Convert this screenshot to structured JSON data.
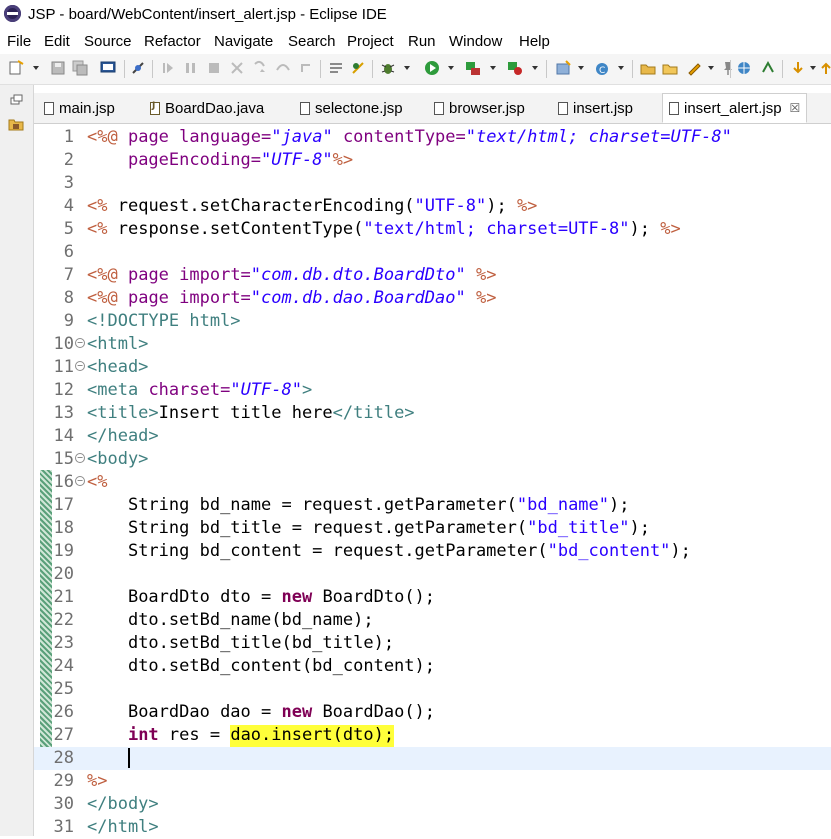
{
  "window": {
    "title": "JSP - board/WebContent/insert_alert.jsp - Eclipse IDE"
  },
  "menu": [
    "File",
    "Edit",
    "Source",
    "Refactor",
    "Navigate",
    "Search",
    "Project",
    "Run",
    "Window",
    "Help"
  ],
  "tabs": [
    {
      "label": "main.jsp",
      "icon": "jsp-file-icon"
    },
    {
      "label": "BoardDao.java",
      "icon": "java-file-icon"
    },
    {
      "label": "selectone.jsp",
      "icon": "jsp-file-icon"
    },
    {
      "label": "browser.jsp",
      "icon": "jsp-file-icon"
    },
    {
      "label": "insert.jsp",
      "icon": "jsp-file-icon"
    },
    {
      "label": "insert_alert.jsp",
      "icon": "jsp-file-icon",
      "active": true,
      "close": "☒"
    }
  ],
  "editor": {
    "line_numbers": [
      "1",
      "2",
      "3",
      "4",
      "5",
      "6",
      "7",
      "8",
      "9",
      "10",
      "11",
      "12",
      "13",
      "14",
      "15",
      "16",
      "17",
      "18",
      "19",
      "20",
      "21",
      "22",
      "23",
      "24",
      "25",
      "26",
      "27",
      "28",
      "29",
      "30",
      "31"
    ],
    "code": {
      "l1_attr1": "page language=",
      "l1_val1": "\"java\"",
      "l1_attr2": "contentType=",
      "l1_val2": "\"text/html; charset=UTF-8\"",
      "l2_attr": "pageEncoding=",
      "l2_val": "\"UTF-8\"",
      "l4_text": "request.setCharacterEncoding(",
      "l4_str": "\"UTF-8\"",
      "l4_end": ");",
      "l5_text": "response.setContentType(",
      "l5_str": "\"text/html; charset=UTF-8\"",
      "l5_end": ");",
      "l7_attr": "page import=",
      "l7_val": "\"com.db.dto.BoardDto\"",
      "l8_attr": "page import=",
      "l8_val": "\"com.db.dao.BoardDao\"",
      "l9_tag": "<!DOCTYPE html>",
      "l10_tag": "<html>",
      "l11_tag": "<head>",
      "l12_tag": "<meta",
      "l12_attr": "charset=",
      "l12_val": "\"UTF-8\"",
      "l12_end": ">",
      "l13_open": "<title>",
      "l13_text": "Insert title here",
      "l13_close": "</title>",
      "l14_tag": "</head>",
      "l15_tag": "<body>",
      "l17_text": "String bd_name = request.getParameter(",
      "l17_str": "\"bd_name\"",
      "l18_text": "String bd_title = request.getParameter(",
      "l18_str": "\"bd_title\"",
      "l19_text": "String bd_content = request.getParameter(",
      "l19_str": "\"bd_content\"",
      "l21_a": "BoardDto dto = ",
      "l21_kw": "new",
      "l21_b": " BoardDto();",
      "l22": "dto.setBd_name(bd_name);",
      "l23": "dto.setBd_title(bd_title);",
      "l24": "dto.setBd_content(bd_content);",
      "l26_a": "BoardDao dao = ",
      "l26_kw": "new",
      "l26_b": " BoardDao();",
      "l27_kw": "int",
      "l27_a": " res = ",
      "l27_hl": "dao.insert(dto);",
      "l30_tag": "</body>",
      "l31_tag": "</html>"
    }
  },
  "colors": {
    "highlight": "#ffff3a",
    "current_line": "#e8f2fe",
    "keyword": "#7f0055",
    "string": "#2a00ff",
    "tag": "#3f7f7f",
    "jsp_delimiter": "#bf5f3f"
  }
}
